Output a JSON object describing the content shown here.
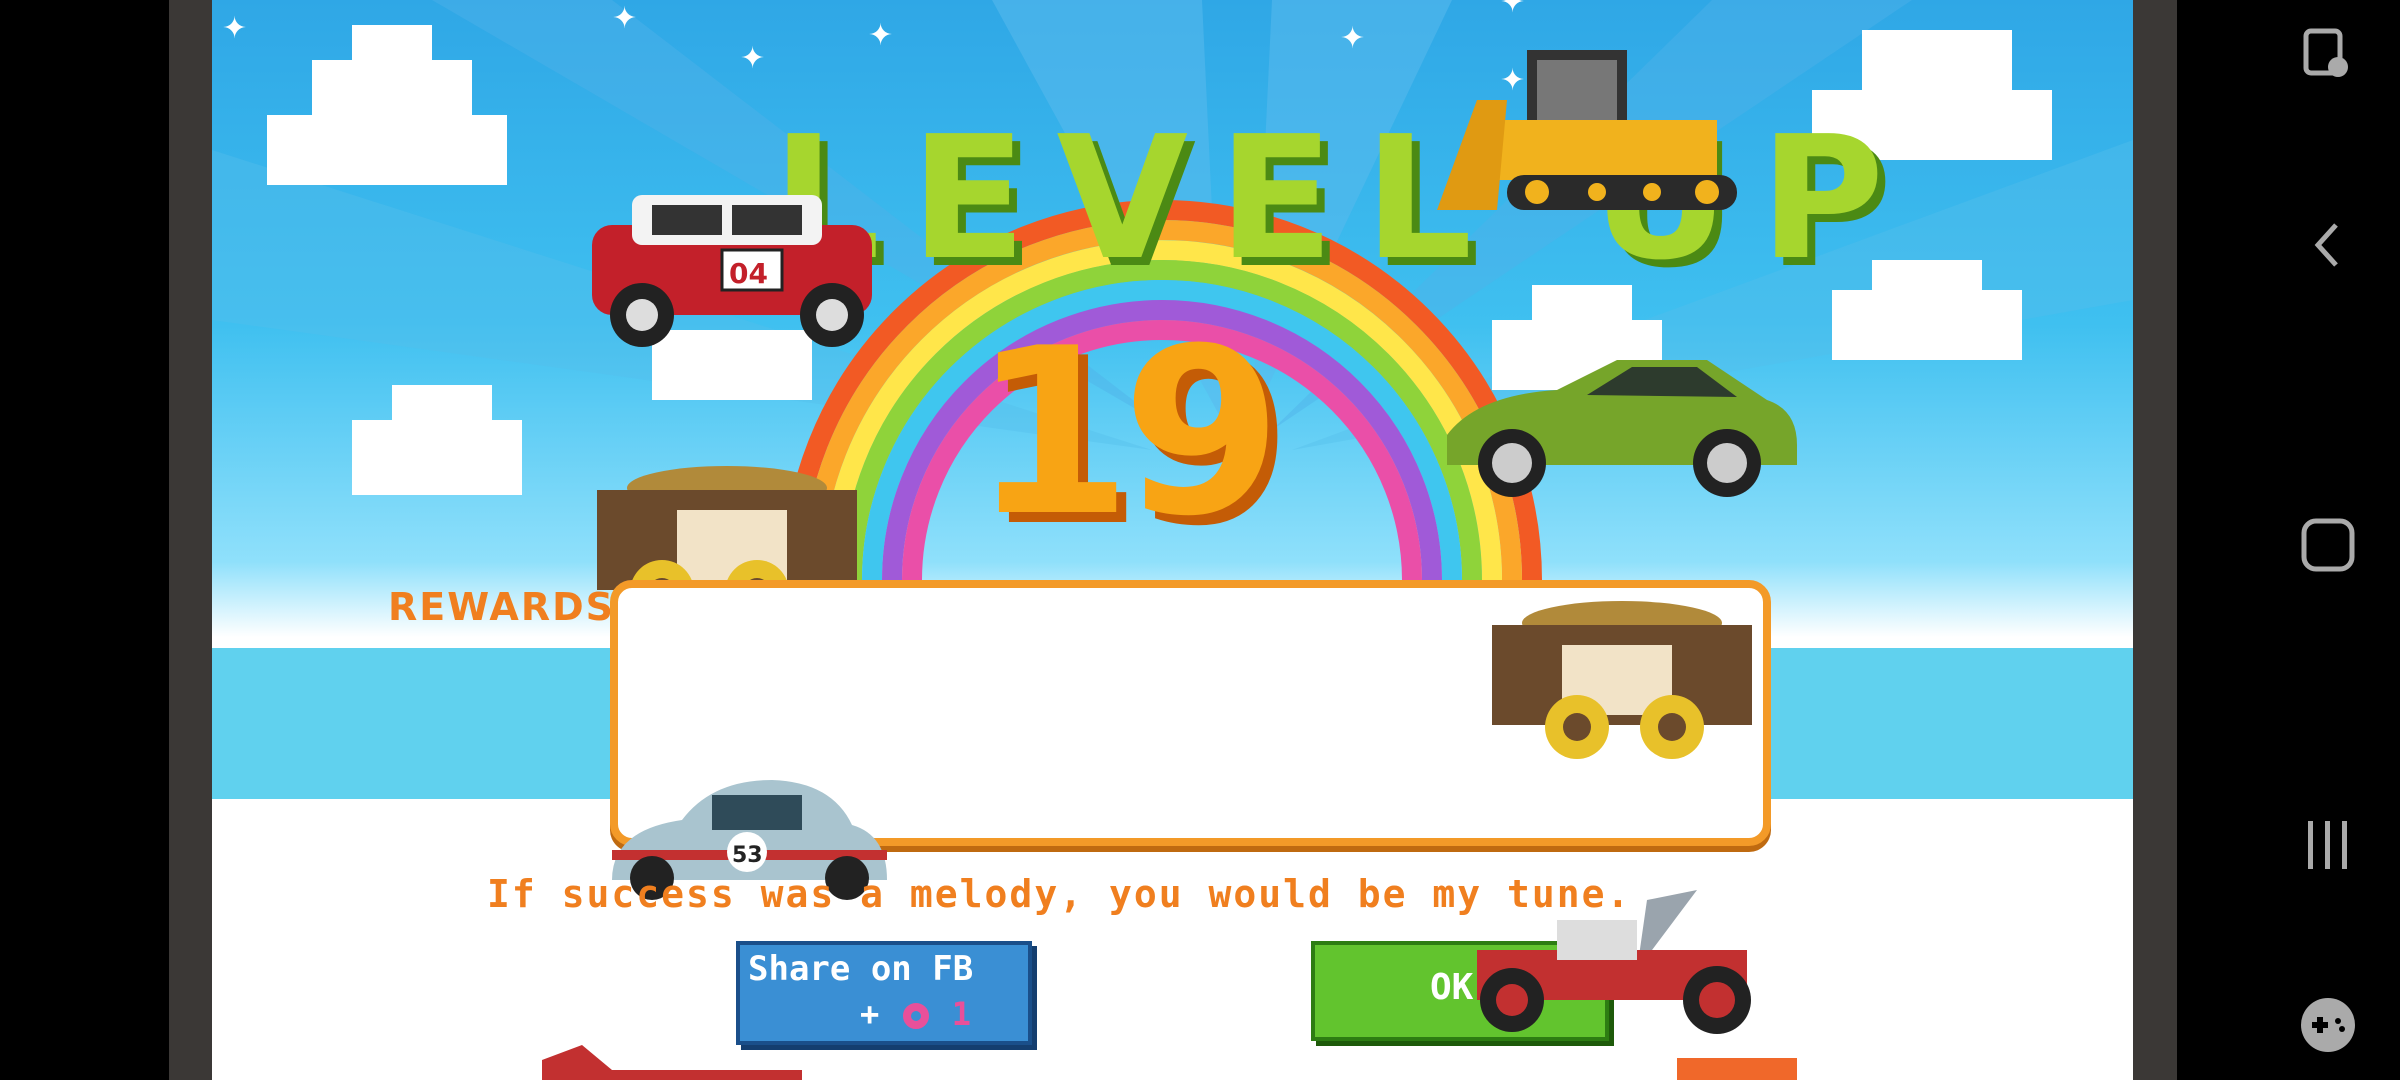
{
  "screen": {
    "title_text": "LEVEL UP",
    "level_number": "19",
    "rewards_label": "REWARDS",
    "tagline": "If success was a melody, you would be my tune.",
    "share_button": {
      "label": "Share on FB",
      "reward_prefix": "+",
      "reward_amount": "1",
      "reward_icon": "donut-icon"
    },
    "ok_button": {
      "label": "OK"
    }
  },
  "navbar": {
    "icons": [
      "screen-overlay-icon",
      "back-icon",
      "home-icon",
      "recents-icon",
      "game-launcher-icon"
    ]
  },
  "colors": {
    "title_green": "#a6d62e",
    "number_orange": "#f8a414",
    "text_orange": "#f07f1f",
    "fb_blue": "#3a8fd4",
    "ok_green": "#62c42e"
  }
}
